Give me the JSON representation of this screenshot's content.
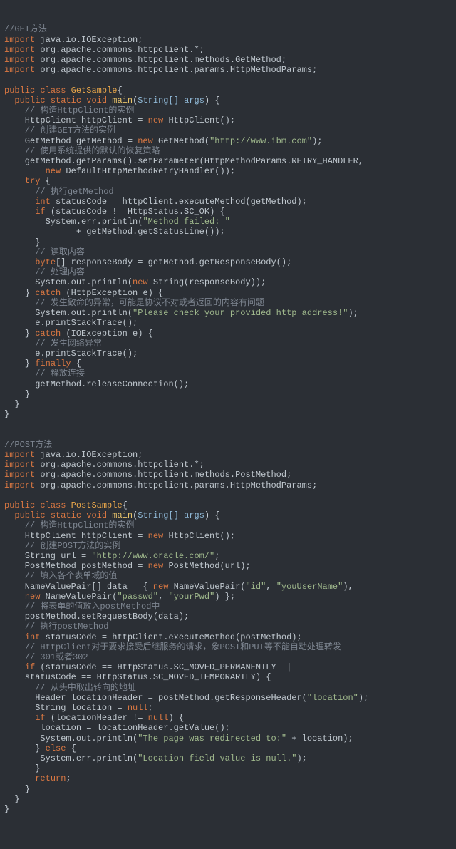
{
  "code": {
    "c_get": "//GET方法",
    "imp1": "import",
    "pkg_io": " java.io.IOException;",
    "imp2": "import",
    "pkg_hc": " org.apache.commons.httpclient.*;",
    "imp3": "import",
    "pkg_getm": " org.apache.commons.httpclient.methods.GetMethod;",
    "imp4": "import",
    "pkg_parms": " org.apache.commons.httpclient.params.HttpMethodParams;",
    "pub": "public",
    "cls": "class",
    "stat": "static",
    "void": "void",
    "get_sample": "GetSample",
    "main": "main",
    "args": "String[] args",
    "obr": "{",
    "cbr": "}",
    "lp": "(",
    "rp": ")",
    "sc": ";",
    "cm": ",",
    "c_build_hc": "// 构造HttpClient的实例",
    "hc_decl": "    HttpClient httpClient = ",
    "new": "new",
    "hc_ctor": " HttpClient();",
    "c_build_get": "// 创建GET方法的实例",
    "gm_decl": "    GetMethod getMethod = ",
    "gm_ctor": " GetMethod(",
    "url_ibm": "\"http://www.ibm.com\"",
    "endcall": ");",
    "c_default": "// 使用系统提供的默认的恢复策略",
    "setparam1": "    getMethod.getParams().setParameter(HttpMethodParams.RETRY_HANDLER,",
    "retry_ctor": " DefaultHttpMethodRetryHandler());",
    "try": "try",
    "c_exec": "// 执行getMethod",
    "int": "int",
    "sc_exec": " statusCode = httpClient.executeMethod(getMethod);",
    "if": "if",
    "cond_ok": " (statusCode != HttpStatus.SC_OK) {",
    "err_pr": "        System.err.println(",
    "mf": "\"Method failed: \"",
    "plus_status": "              + getMethod.getStatusLine());",
    "c_read": "// 读取内容",
    "byte": "byte",
    "rb": "[] responseBody = getMethod.getResponseBody();",
    "c_handle": "// 处理内容",
    "out_pr": "      System.out.println(",
    "str_ctor": " String(responseBody));",
    "catch": "catch",
    "hex": " (HttpException e) {",
    "c_fatal": "// 发生致命的异常，可能是协议不对或者返回的内容有问题",
    "out_pr2": "      System.out.println(",
    "chk": "\"Please check your provided http address!\"",
    "est": "      e.printStackTrace();",
    "ioex": " (IOException e) {",
    "c_net": "// 发生网络异常",
    "finally": "finally",
    "c_rel": "// 释放连接",
    "rel": "      getMethod.releaseConnection();",
    "c_post": "//POST方法",
    "pkg_postm": " org.apache.commons.httpclient.methods.PostMethod;",
    "post_sample": "PostSample",
    "c_build_post": "// 创建POST方法的实例",
    "url_decl": "    String url = ",
    "url_oracle": "\"http://www.oracle.com/\"",
    "pm_decl": "    PostMethod postMethod = ",
    "pm_ctor": " PostMethod(url);",
    "c_fill": "// 填入各个表单域的值",
    "nvp_decl": "    NameValuePair[] data = { ",
    "nvp": " NameValuePair(",
    "id": "\"id\"",
    "youu": "\"youUserName\"",
    "rp2": "),",
    "nvp2_lead": "    ",
    "pwdk": "\"passwd\"",
    "pwdv": "\"yourPwd\"",
    "end_arr": ") };",
    "c_setreq": "// 将表单的值放入postMethod中",
    "setreq": "    postMethod.setRequestBody(data);",
    "c_exec2": "// 执行postMethod",
    "sc_exec2": " statusCode = httpClient.executeMethod(postMethod);",
    "c_httpclient301": "// HttpClient对于要求接受后继服务的请求，象POST和PUT等不能自动处理转发",
    "c_301": "// 301或者302",
    "cond_301a": " (statusCode == HttpStatus.SC_MOVED_PERMANENTLY ||",
    "cond_301b": "    statusCode == HttpStatus.SC_MOVED_TEMPORARILY) {",
    "c_redir": "// 从头中取出转向的地址",
    "hdr": "      Header locationHeader = postMethod.getResponseHeader(",
    "loc": "\"location\"",
    "locstr": "      String location = ",
    "null": "null",
    "cond_lh": " (locationHeader != ",
    "getval": "       location = locationHeader.getValue();",
    "out_pr3": "       System.out.println(",
    "redir": "\"The page was redirected to:\"",
    "plusloc": " + location);",
    "else": "else",
    "err_pr2": "       System.err.println(",
    "locnull": "\"Location field value is null.\"",
    "return": "return"
  }
}
